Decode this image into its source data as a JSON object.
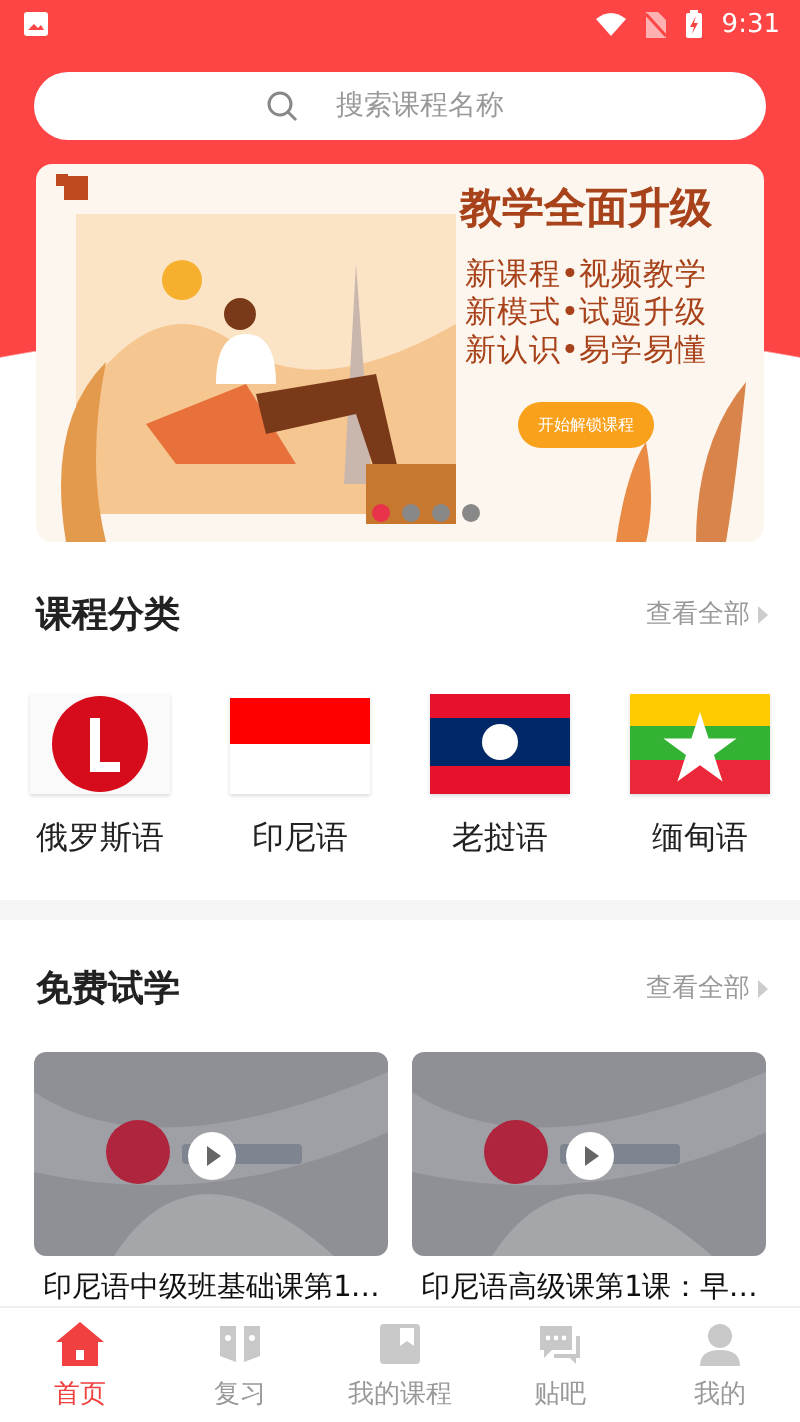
{
  "status_bar": {
    "time": "9:31"
  },
  "search": {
    "placeholder": "搜索课程名称"
  },
  "banner": {
    "title": "教学全面升级",
    "lines": [
      "新课程•视频教学",
      "新模式•试题升级",
      "新认识•易学易懂"
    ],
    "button": "开始解锁课程",
    "dots": [
      {
        "selected": true
      },
      {
        "selected": false
      },
      {
        "selected": false
      },
      {
        "selected": false
      }
    ]
  },
  "categories": {
    "title": "课程分类",
    "more": "查看全部",
    "items": [
      {
        "label": "俄罗斯语"
      },
      {
        "label": "印尼语"
      },
      {
        "label": "老挝语"
      },
      {
        "label": "缅甸语"
      }
    ]
  },
  "free_trial": {
    "title": "免费试学",
    "more": "查看全部",
    "videos": [
      {
        "title": "印尼语中级班基础课第1…"
      },
      {
        "title": "印尼语高级课第1课：早…"
      }
    ]
  },
  "tab_bar": [
    {
      "label": "首页",
      "selected": true
    },
    {
      "label": "复习",
      "selected": false
    },
    {
      "label": "我的课程",
      "selected": false
    },
    {
      "label": "贴吧",
      "selected": false
    },
    {
      "label": "我的",
      "selected": false
    }
  ]
}
